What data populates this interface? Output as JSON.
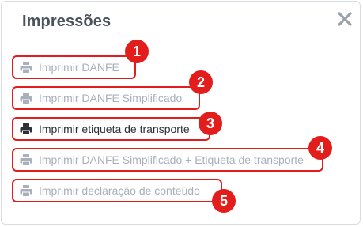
{
  "dialog": {
    "title": "Impressões",
    "close_icon": "close-icon"
  },
  "items": [
    {
      "label": "Imprimir DANFE",
      "badge": "1",
      "icon": "printer-icon",
      "state": "disabled"
    },
    {
      "label": "Imprimir DANFE Simplificado",
      "badge": "2",
      "icon": "printer-icon",
      "state": "disabled"
    },
    {
      "label": "Imprimir etiqueta de transporte",
      "badge": "3",
      "icon": "printer-icon",
      "state": "enabled"
    },
    {
      "label": "Imprimir DANFE Simplificado + Etiqueta de transporte",
      "badge": "4",
      "icon": "printer-icon",
      "state": "disabled"
    },
    {
      "label": "Imprimir declaração de conteúdo",
      "badge": "5",
      "icon": "printer-icon",
      "state": "disabled"
    }
  ],
  "colors": {
    "highlight": "#e31c1c",
    "title": "#4a5260",
    "disabled_text": "#a9b0bb",
    "enabled_text": "#2d3036"
  }
}
